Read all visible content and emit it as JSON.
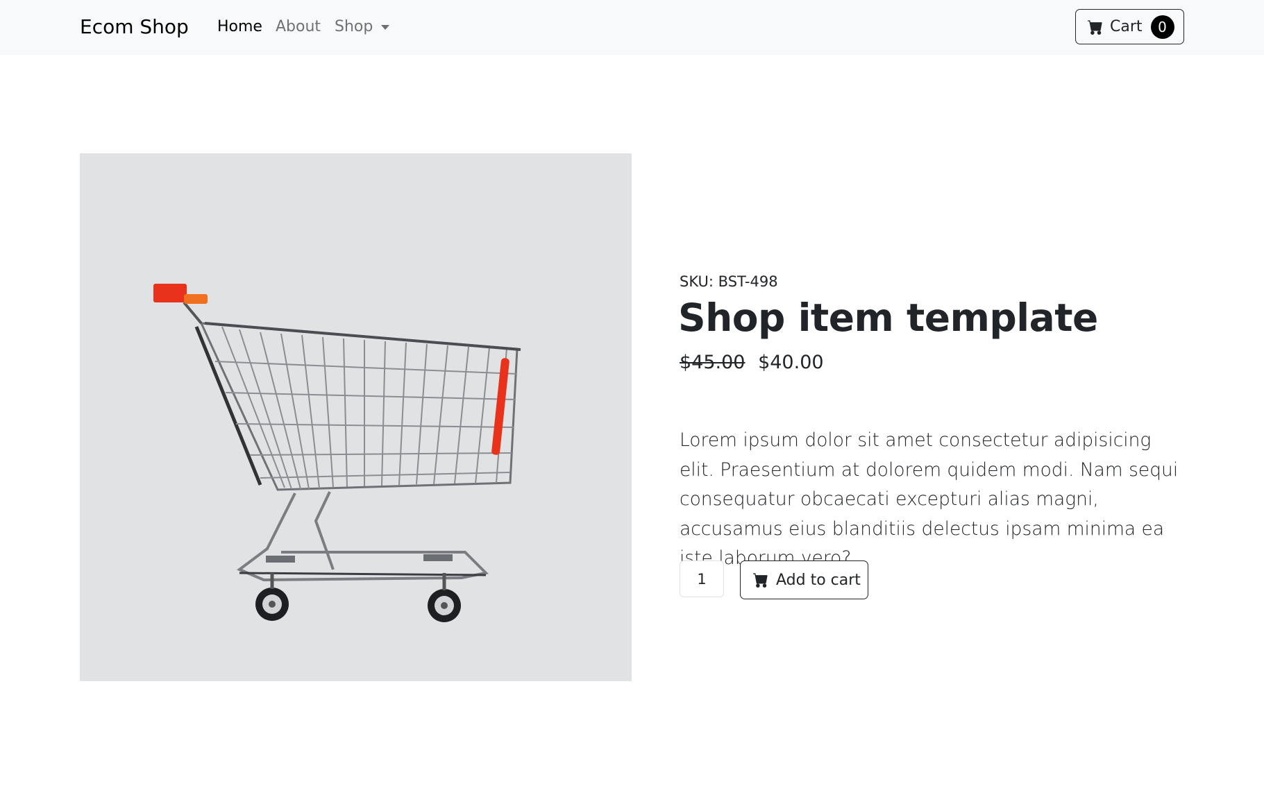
{
  "navbar": {
    "brand": "Ecom Shop",
    "links": [
      {
        "label": "Home",
        "active": true
      },
      {
        "label": "About",
        "active": false
      },
      {
        "label": "Shop",
        "active": false,
        "dropdown": true
      }
    ],
    "cart": {
      "label": "Cart",
      "count": "0",
      "icon": "cart-icon"
    }
  },
  "product": {
    "sku": "SKU: BST-498",
    "title": "Shop item template",
    "old_price": "$45.00",
    "price": "$40.00",
    "description": "Lorem ipsum dolor sit amet consectetur adipisicing elit. Praesentium at dolorem quidem modi. Nam sequi consequatur obcaecati excepturi alias magni, accusamus eius blanditiis delectus ipsam minima ea iste laborum vero?",
    "quantity": "1",
    "add_to_cart_label": "Add to cart",
    "image": "shopping-cart-image"
  },
  "colors": {
    "navbar_bg": "#f8f9fa",
    "image_bg": "#e1e2e4",
    "cart_handle": "#e8321c",
    "text": "#212529"
  }
}
